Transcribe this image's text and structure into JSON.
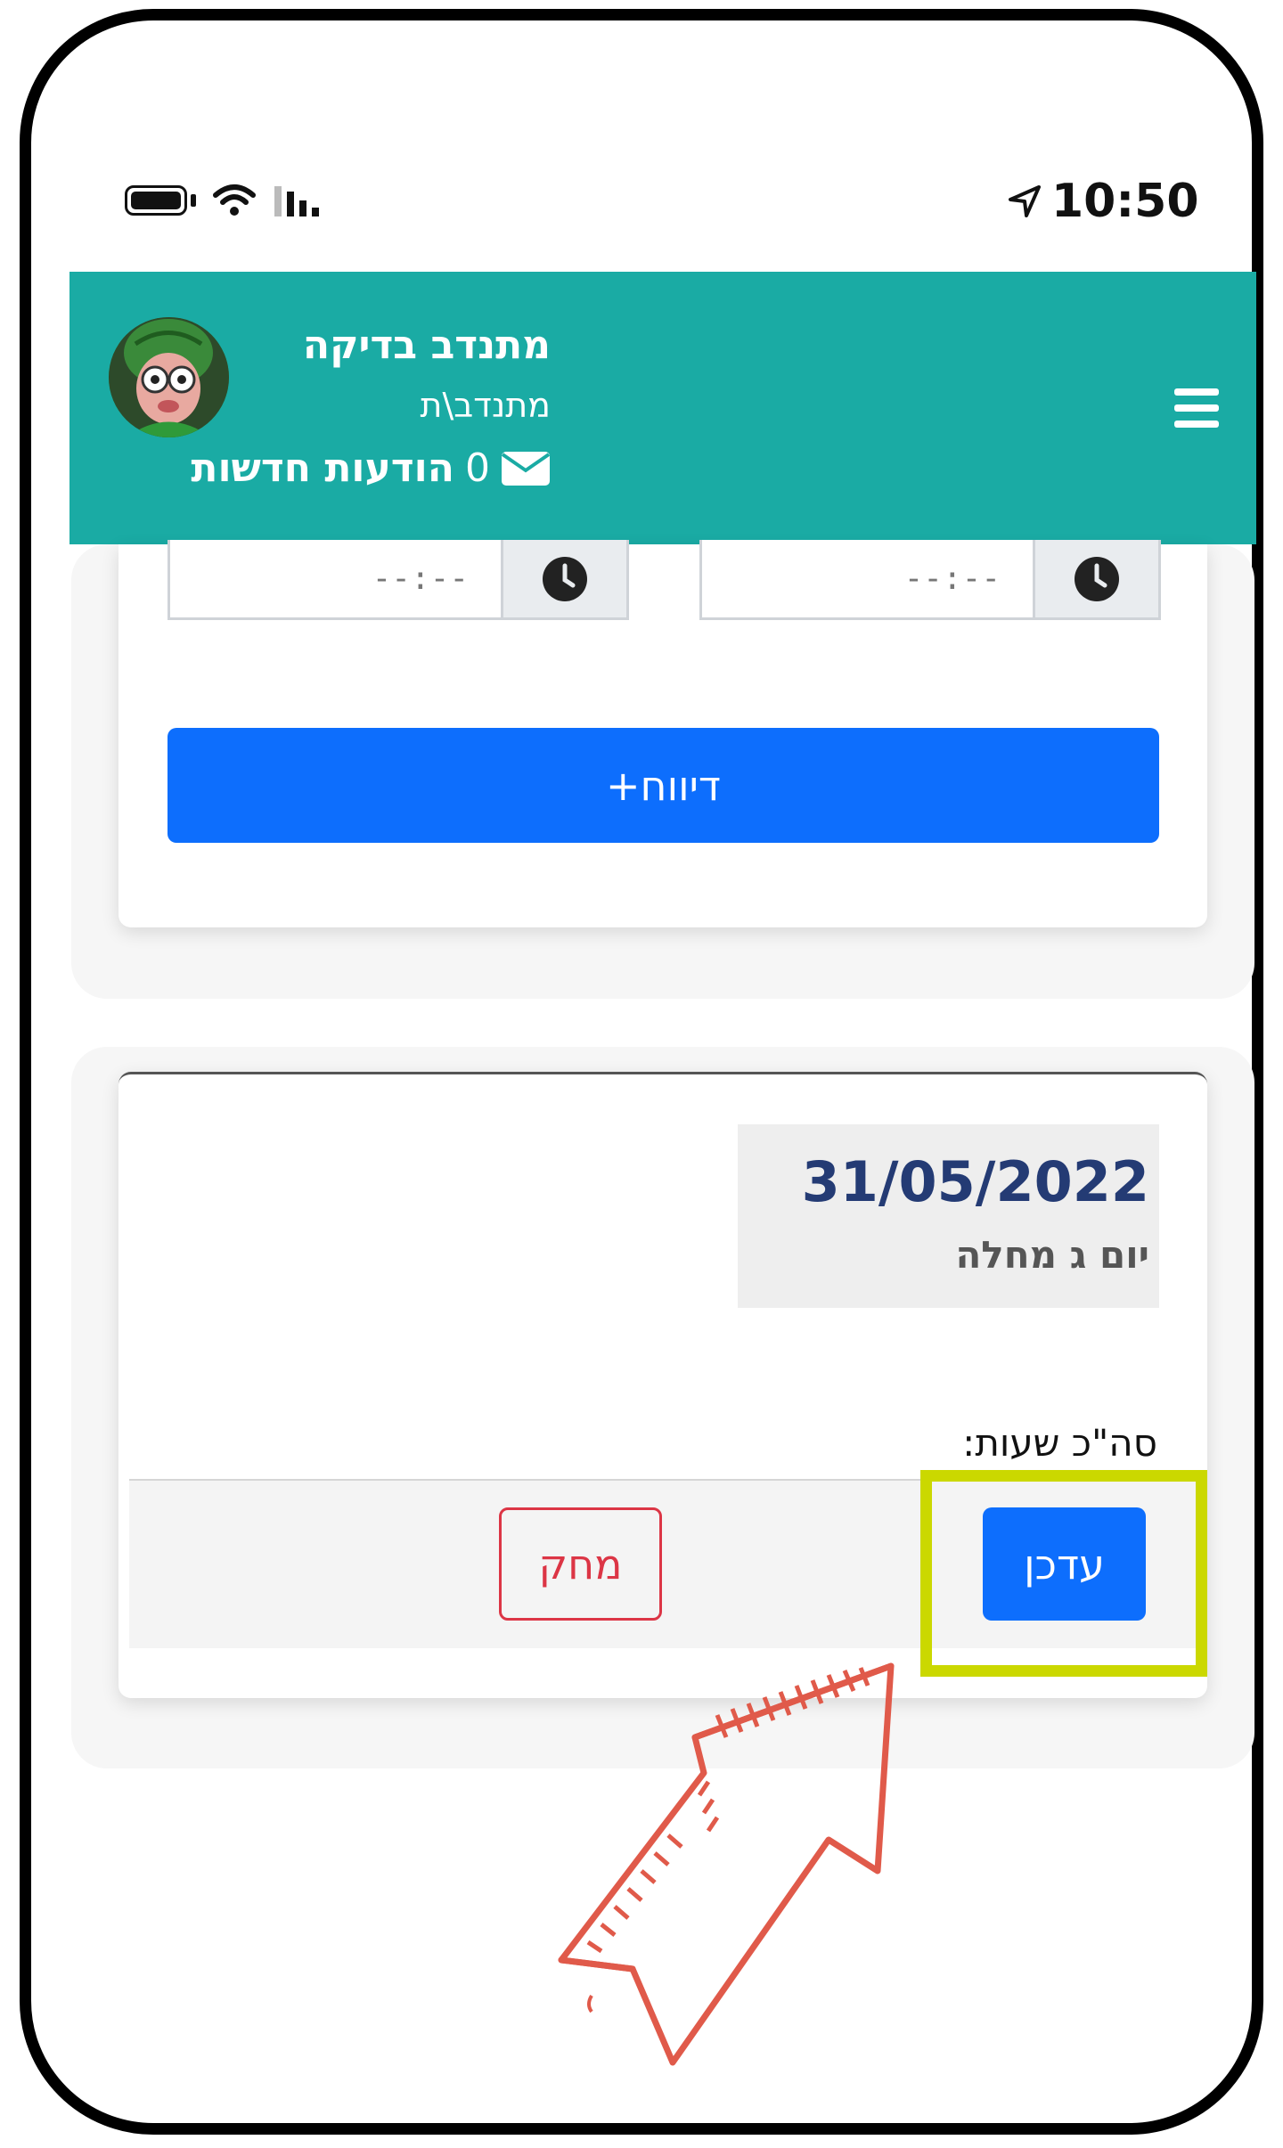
{
  "status_bar": {
    "time": "10:50"
  },
  "header": {
    "user_name": "מתנדב בדיקה",
    "user_role": "מתנדב\\ת",
    "messages_count": "0",
    "messages_label": "הודעות חדשות"
  },
  "form": {
    "start_time_value": "--:--",
    "end_time_value": "--:--",
    "report_button": "דיווח+"
  },
  "entry": {
    "date": "31/05/2022",
    "day_label": "יום ג מחלה",
    "total_hours_label": "סה\"כ שעות:",
    "update_button": "עדכן",
    "delete_button": "מחק"
  },
  "colors": {
    "header": "#1aaba4",
    "primary": "#0d6efd",
    "danger": "#dc3545",
    "highlight": "#cbd800",
    "annotation_arrow": "#e05a4a"
  }
}
